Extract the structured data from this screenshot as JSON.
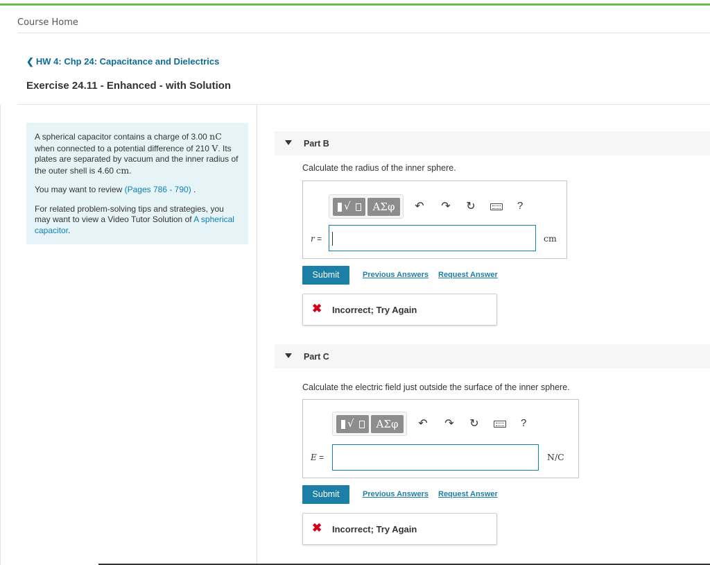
{
  "nav": {
    "course_home": "Course Home",
    "back_link": "HW 4: Chp 24: Capacitance and Dielectrics",
    "exercise_title": "Exercise 24.11 - Enhanced - with Solution"
  },
  "intro": {
    "p1_a": "A spherical capacitor contains a charge of 3.00 ",
    "p1_charge_unit": "nC",
    "p1_b": " when connected to a potential difference of 210 ",
    "p1_volt_unit": "V",
    "p1_c": ". Its plates are separated by vacuum and the inner radius of the outer shell is 4.60 ",
    "p1_len_unit": "cm",
    "p1_d": ".",
    "p2_a": "You may want to review ",
    "p2_link": "(Pages 786 - 790)",
    "p2_b": " .",
    "p3_a": "For related problem-solving tips and strategies, you may want to view a Video Tutor Solution of ",
    "p3_link": "A spherical capacitor",
    "p3_b": "."
  },
  "toolbar": {
    "greek_label": "ΑΣφ",
    "sqrt_symbol": "√",
    "undo_icon": "↶",
    "redo_icon": "↷",
    "reset_icon": "↻",
    "help_label": "?"
  },
  "parts": [
    {
      "label": "Part B",
      "question": "Calculate the radius of the inner sphere.",
      "variable": "r",
      "equals": " =",
      "value": "",
      "unit": "cm",
      "submit": "Submit",
      "previous_answers": "Previous Answers",
      "request_answer": "Request Answer",
      "feedback_icon": "✖",
      "feedback": "Incorrect; Try Again"
    },
    {
      "label": "Part C",
      "question": "Calculate the electric field just outside the surface of the inner sphere.",
      "variable": "E",
      "equals": " =",
      "value": "",
      "unit": "N/C",
      "submit": "Submit",
      "previous_answers": "Previous Answers",
      "request_answer": "Request Answer",
      "feedback_icon": "✖",
      "feedback": "Incorrect; Try Again"
    }
  ],
  "colors": {
    "accent_green": "#6cbd45",
    "link_blue": "#0e6d97",
    "submit_blue": "#1b7fa6",
    "error_red": "#d0021b",
    "intro_bg": "#e6f4f7"
  }
}
